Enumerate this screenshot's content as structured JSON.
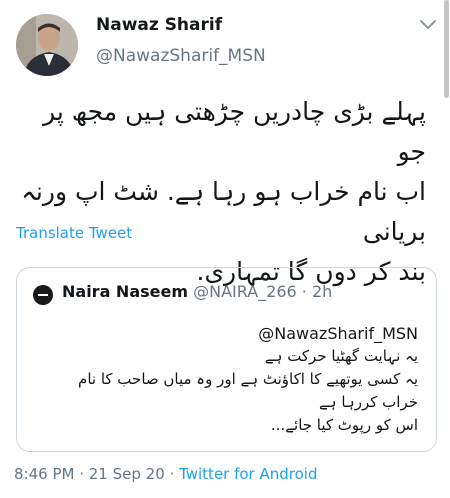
{
  "tweet": {
    "display_name": "Nawaz Sharif",
    "handle": "@NawazSharif_MSN",
    "text_lines": [
      "پہلے بڑی چادریں چڑھتی ہیں مجھ پر جو",
      "اب نام خراب ہو رہا ہے. شٹ اپ ورنہ بریانی",
      "بند کر دوں گا تمہاری."
    ],
    "translate_label": "Translate Tweet"
  },
  "quoted": {
    "name": "Naira Naseem",
    "handle": "@NAIRA_266",
    "separator": "·",
    "time": "2h",
    "mention": "@NawazSharif_MSN",
    "lines": [
      "یہ نہایت گھٹیا حرکت ہے",
      "یہ کسی یوتھیے کا اکاؤنٹ ہے اور وہ میاں صاحب کا نام",
      "خراب کررہا ہے",
      "اس کو رپوٹ کیا جائے..."
    ]
  },
  "footer": {
    "time": "8:46 PM",
    "sep1": " · ",
    "date": "21 Sep 20",
    "sep2": " · ",
    "source": "Twitter for Android"
  },
  "colors": {
    "link": "#1da1f2",
    "muted": "#657786",
    "border": "#ccd6dd"
  },
  "icons": {
    "caret": "chevron-down-icon"
  }
}
